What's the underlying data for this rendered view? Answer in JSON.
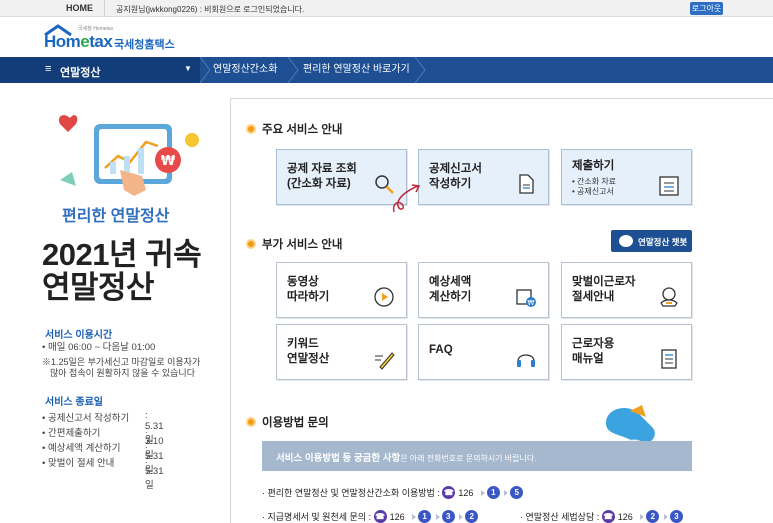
{
  "topbar": {
    "home": "HOME",
    "notice": "공지원님(jwkkong0226) : 비회원으로 로그인되었습니다.",
    "logout": "로그아웃"
  },
  "logo": {
    "tagline": "국세청 Hometax",
    "brand_prefix": "Hom",
    "brand_e": "e",
    "brand_suffix": "tax",
    "korean": "국세청홈택스"
  },
  "nav": {
    "main": "연말정산",
    "items": [
      "연말정산간소화",
      "편리한 연말정산 바로가기"
    ]
  },
  "left": {
    "hero_title": "편리한 연말정산",
    "big_title_1": "2021년 귀속",
    "big_title_2": "연말정산",
    "service_time_head": "서비스 이용시간",
    "service_time": "• 매일 06:00 ~ 다음날 01:00",
    "service_note_1": "※1.25일은 부가세신고 마감일로 이용자가",
    "service_note_2": "많아 접속이 원활하지 않을 수 있습니다",
    "end_head": "서비스 종료일",
    "end_items": [
      {
        "label": "• 공제신고서 작성하기",
        "date": ": 5.31일"
      },
      {
        "label": "• 간편제출하기",
        "date": ": 3.10일"
      },
      {
        "label": "• 예상세액 계산하기",
        "date": ": 5.31일"
      },
      {
        "label": "• 맞벌이 절세 안내",
        "date": ": 5.31일"
      }
    ]
  },
  "main": {
    "section1": "주요 서비스 안내",
    "section2": "부가 서비스 안내",
    "section3": "이용방법 문의",
    "chatbot": "연말정산 챗봇",
    "main_cards": [
      {
        "line1": "공제 자료 조회",
        "line2": "(간소화 자료)"
      },
      {
        "line1": "공제신고서",
        "line2": "작성하기"
      },
      {
        "line1": "제출하기",
        "sub1": "• 간소화 자료",
        "sub2": "• 공제신고서"
      }
    ],
    "extra_cards": [
      {
        "line1": "동영상",
        "line2": "따라하기"
      },
      {
        "line1": "예상세액",
        "line2": "계산하기"
      },
      {
        "line1": "맞벌이근로자",
        "line2": "절세안내"
      },
      {
        "line1": "키워드",
        "line2": "연말정산"
      },
      {
        "line1": "FAQ",
        "line2": ""
      },
      {
        "line1": "근로자용",
        "line2": "매뉴얼"
      }
    ],
    "banner_bold": "서비스 이용방법 등 궁금한 사항",
    "banner_rest": "은 아래 전화번호로 문의하시기 바랍니다.",
    "phone1_label": "· 편리한 연말정산 및 연말정산간소화 이용방법 :",
    "phone2_label": "· 지급명세서 및 원천세 문의 :",
    "phone3_label": "· 연말정산 세법상담 :",
    "tel": "126",
    "seq1": [
      "1",
      "5"
    ],
    "seq2": [
      "1",
      "3",
      "2"
    ],
    "seq3": [
      "2",
      "3"
    ]
  }
}
